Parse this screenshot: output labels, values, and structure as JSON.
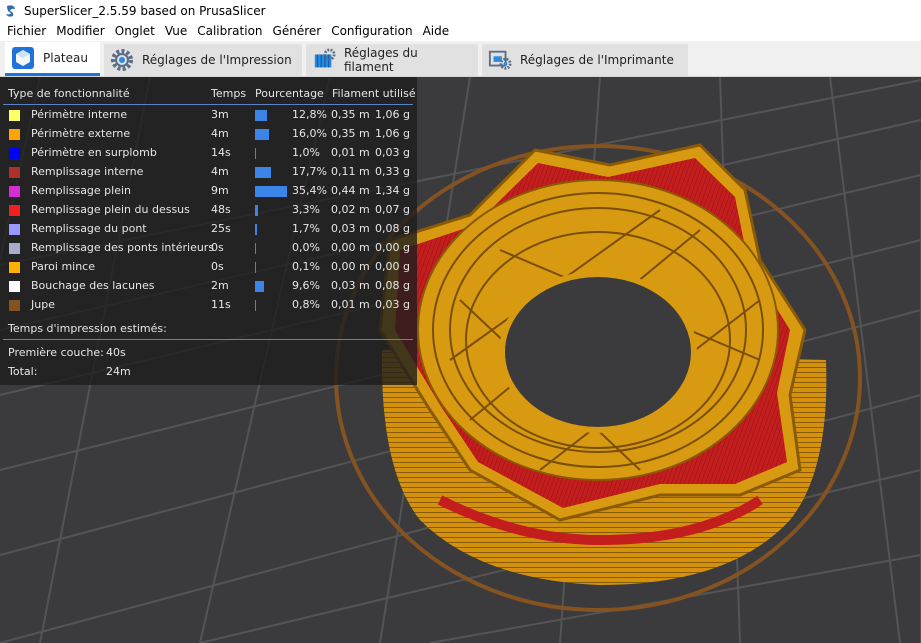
{
  "window": {
    "title": "SuperSlicer_2.5.59  based on PrusaSlicer"
  },
  "menu": [
    "Fichier",
    "Modifier",
    "Onglet",
    "Vue",
    "Calibration",
    "Générer",
    "Configuration",
    "Aide"
  ],
  "tabs": [
    {
      "label": "Plateau",
      "icon": "cube-icon",
      "active": true
    },
    {
      "label": "Réglages de l'Impression",
      "icon": "gear-icon",
      "active": false
    },
    {
      "label": "Réglages du filament",
      "icon": "filament-spool-icon",
      "active": false
    },
    {
      "label": "Réglages de l'Imprimante",
      "icon": "printer-gear-icon",
      "active": false
    }
  ],
  "legend": {
    "headers": {
      "type": "Type de fonctionnalité",
      "time": "Temps",
      "percent": "Pourcentage",
      "filament": "Filament utilisé"
    },
    "rows": [
      {
        "name": "Périmètre interne",
        "color": "#ffff68",
        "time": "3m",
        "pct": "12,8%",
        "pct_value": 12.8,
        "length": "0,35 m",
        "weight": "1,06 g"
      },
      {
        "name": "Périmètre externe",
        "color": "#ffa500",
        "time": "4m",
        "pct": "16,0%",
        "pct_value": 16.0,
        "length": "0,35 m",
        "weight": "1,06 g"
      },
      {
        "name": "Périmètre en surplomb",
        "color": "#0000ff",
        "time": "14s",
        "pct": "1,0%",
        "pct_value": 1.0,
        "length": "0,01 m",
        "weight": "0,03 g"
      },
      {
        "name": "Remplissage interne",
        "color": "#b03029",
        "time": "4m",
        "pct": "17,7%",
        "pct_value": 17.7,
        "length": "0,11 m",
        "weight": "0,33 g"
      },
      {
        "name": "Remplissage plein",
        "color": "#d22ed2",
        "time": "9m",
        "pct": "35,4%",
        "pct_value": 35.4,
        "length": "0,44 m",
        "weight": "1,34 g"
      },
      {
        "name": "Remplissage plein du dessus",
        "color": "#f02020",
        "time": "48s",
        "pct": "3,3%",
        "pct_value": 3.3,
        "length": "0,02 m",
        "weight": "0,07 g"
      },
      {
        "name": "Remplissage du pont",
        "color": "#9999ff",
        "time": "25s",
        "pct": "1,7%",
        "pct_value": 1.7,
        "length": "0,03 m",
        "weight": "0,08 g"
      },
      {
        "name": "Remplissage des ponts intérieurs",
        "color": "#aaaacc",
        "time": "0s",
        "pct": "0,0%",
        "pct_value": 0.0,
        "length": "0,00 m",
        "weight": "0,00 g"
      },
      {
        "name": "Paroi mince",
        "color": "#ffb000",
        "time": "0s",
        "pct": "0,1%",
        "pct_value": 0.1,
        "length": "0,00 m",
        "weight": "0,00 g"
      },
      {
        "name": "Bouchage des lacunes",
        "color": "#ffffff",
        "time": "2m",
        "pct": "9,6%",
        "pct_value": 9.6,
        "length": "0,03 m",
        "weight": "0,08 g"
      },
      {
        "name": "Jupe",
        "color": "#845321",
        "time": "11s",
        "pct": "0,8%",
        "pct_value": 0.8,
        "length": "0,01 m",
        "weight": "0,03 g"
      }
    ],
    "estimates_label": "Temps d'impression estimés:",
    "first_layer": {
      "label": "Première couche:",
      "value": "40s"
    },
    "total": {
      "label": "Total:",
      "value": "24m"
    }
  },
  "colors": {
    "accent": "#1f73d8",
    "viewport_bg": "#3b3b3d",
    "model_orange": "#d89a10",
    "model_red": "#c81e1e",
    "skirt": "#845321"
  }
}
